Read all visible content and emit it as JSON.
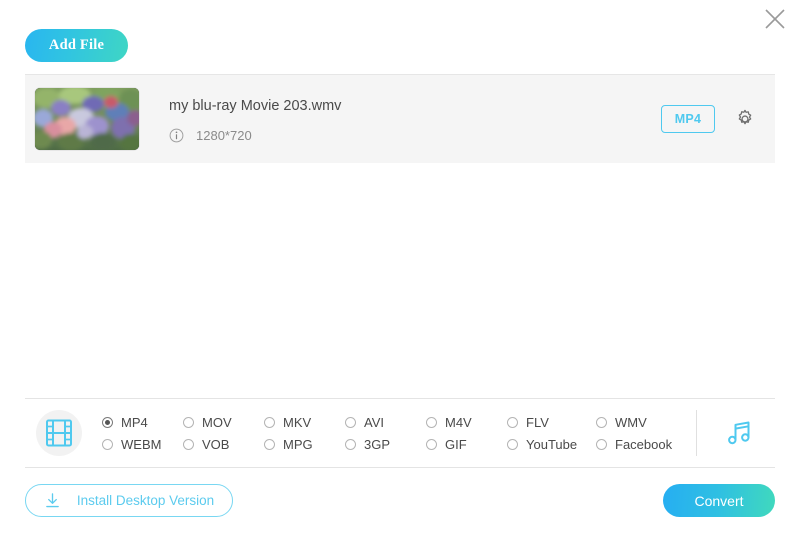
{
  "window": {
    "close_label": "close-icon"
  },
  "toolbar": {
    "add_file_label": "Add File"
  },
  "file_list": {
    "items": [
      {
        "name": "my blu-ray Movie 203.wmv",
        "resolution": "1280*720",
        "target_format": "MP4",
        "info_icon": "info-icon",
        "settings_icon": "gear-icon",
        "thumbnail": "flower-garden-thumbnail"
      }
    ]
  },
  "format_bar": {
    "media_type_icon": "film-strip-icon",
    "audio_icon": "music-note-icon",
    "selected": "MP4",
    "columns": [
      {
        "options": [
          {
            "label": "MP4",
            "selected": true
          },
          {
            "label": "WEBM",
            "selected": false
          }
        ]
      },
      {
        "options": [
          {
            "label": "MOV",
            "selected": false
          },
          {
            "label": "VOB",
            "selected": false
          }
        ]
      },
      {
        "options": [
          {
            "label": "MKV",
            "selected": false
          },
          {
            "label": "MPG",
            "selected": false
          }
        ]
      },
      {
        "options": [
          {
            "label": "AVI",
            "selected": false
          },
          {
            "label": "3GP",
            "selected": false
          }
        ]
      },
      {
        "options": [
          {
            "label": "M4V",
            "selected": false
          },
          {
            "label": "GIF",
            "selected": false
          }
        ]
      },
      {
        "options": [
          {
            "label": "FLV",
            "selected": false
          },
          {
            "label": "YouTube",
            "selected": false
          }
        ]
      },
      {
        "options": [
          {
            "label": "WMV",
            "selected": false
          },
          {
            "label": "Facebook",
            "selected": false
          }
        ]
      }
    ]
  },
  "footer": {
    "install_label": "Install Desktop Version",
    "install_icon": "download-icon",
    "convert_label": "Convert"
  },
  "colors": {
    "accent_cyan": "#4fc9ef",
    "gradient_start": "#26aef2",
    "gradient_end": "#40d9bd",
    "row_bg": "#f5f5f5",
    "text": "#4a4a4a",
    "muted_text": "#8a8a8a"
  }
}
